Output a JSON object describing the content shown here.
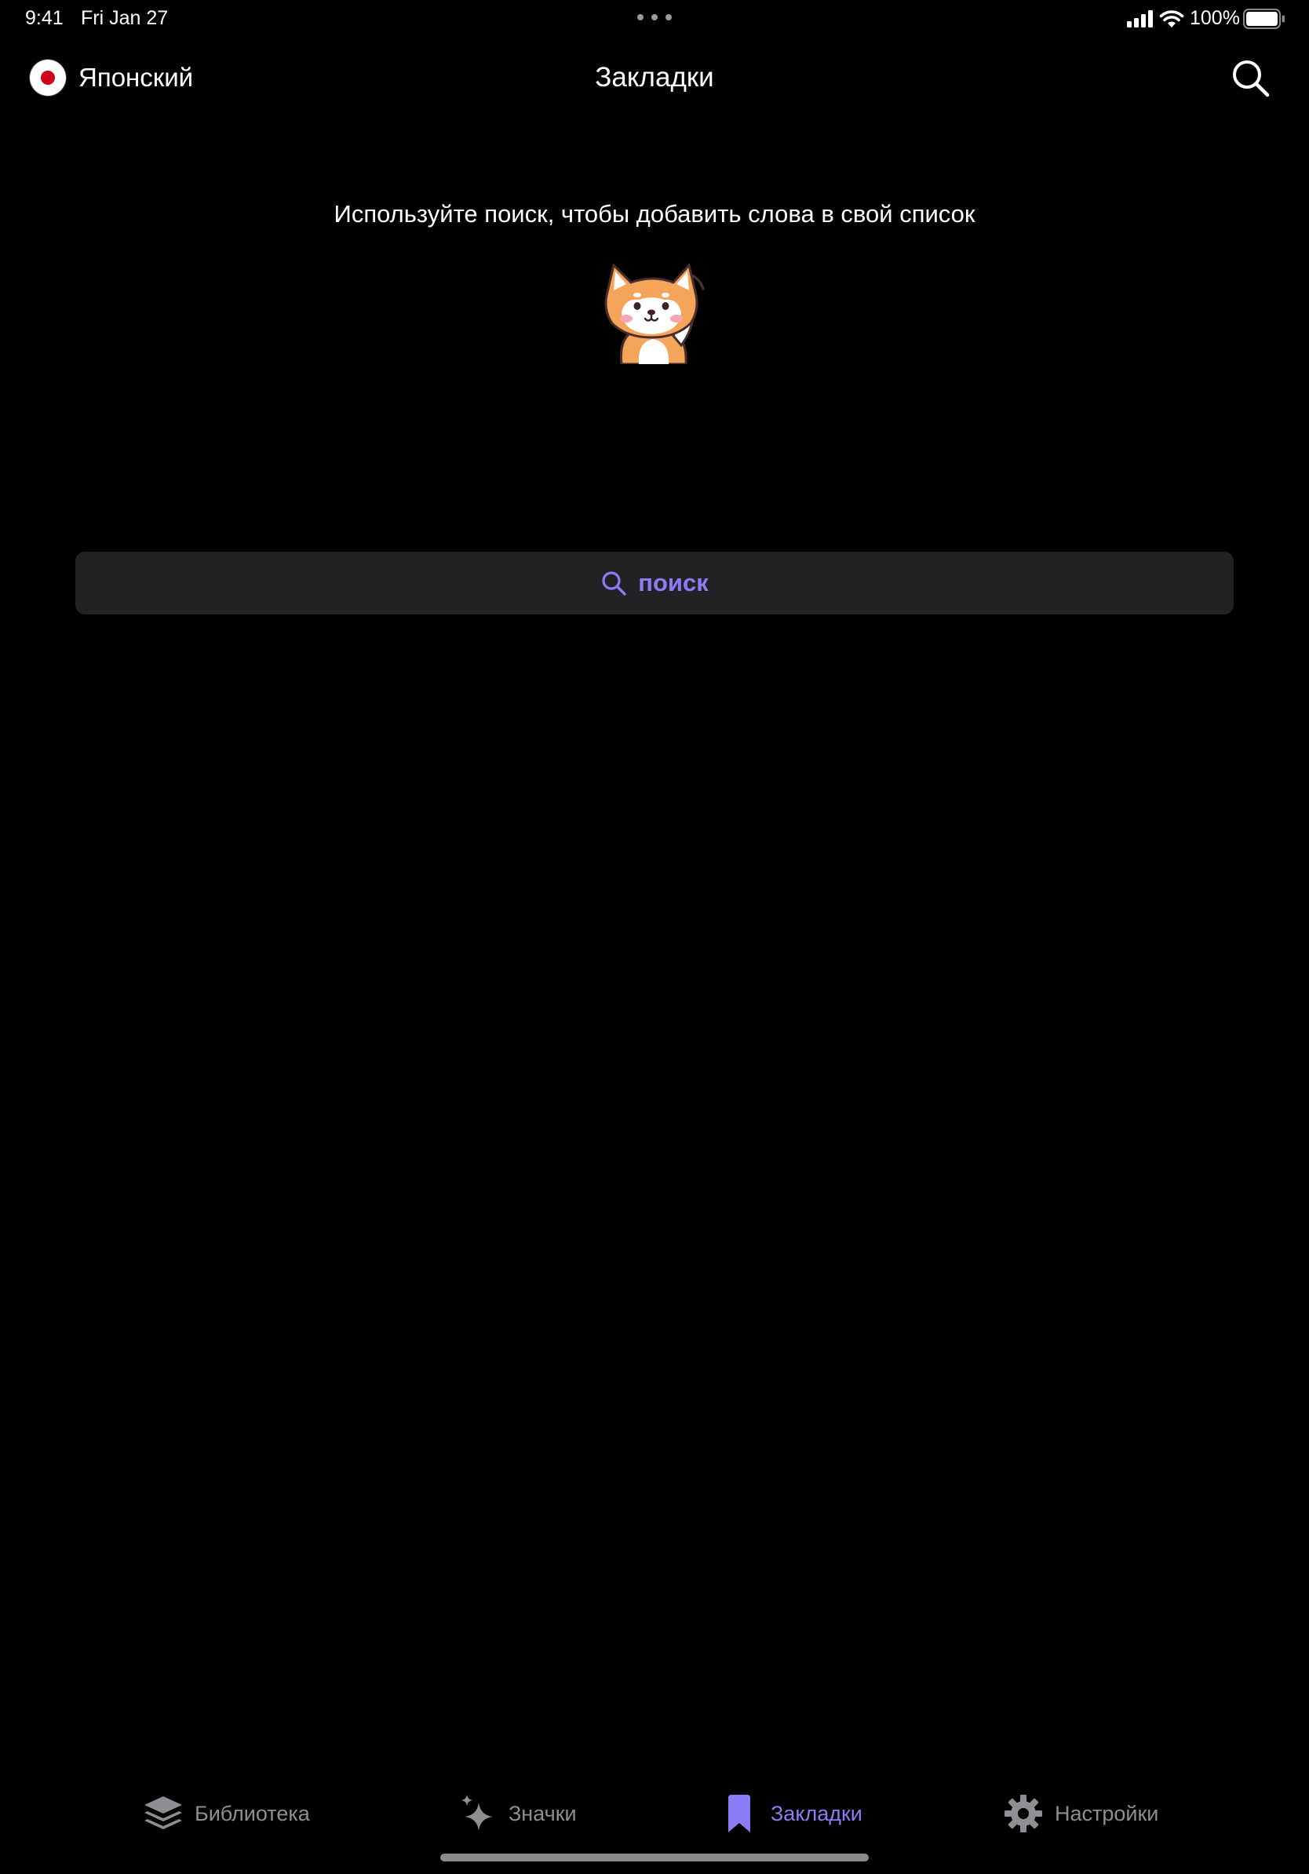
{
  "status_bar": {
    "time": "9:41",
    "date": "Fri Jan 27",
    "battery": "100%"
  },
  "nav": {
    "language": "Японский",
    "title": "Закладки"
  },
  "content": {
    "hint": "Используйте поиск, чтобы добавить слова в свой список",
    "search_button_label": "поиск"
  },
  "tabs": [
    {
      "label": "Библиотека",
      "icon": "layers-icon",
      "active": false
    },
    {
      "label": "Значки",
      "icon": "sparkle-icon",
      "active": false
    },
    {
      "label": "Закладки",
      "icon": "bookmark-icon",
      "active": true
    },
    {
      "label": "Настройки",
      "icon": "gear-icon",
      "active": false
    }
  ],
  "colors": {
    "background": "#000000",
    "accent": "#8b7cf6",
    "inactive": "#8e8e93",
    "button_bg": "#222224"
  }
}
